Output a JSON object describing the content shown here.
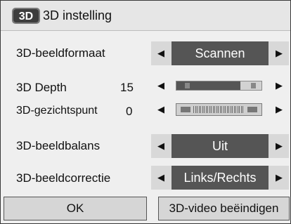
{
  "dialog": {
    "title": "3D instelling",
    "logo_text": "3D"
  },
  "rows": [
    {
      "label": "3D-beeldformaat",
      "value": "Scannen"
    },
    {
      "label": "3D Depth",
      "number": "15",
      "level": 15
    },
    {
      "label": "3D-gezichtspunt",
      "number": "0",
      "level": 0
    },
    {
      "label": "3D-beeldbalans",
      "value": "Uit"
    },
    {
      "label": "3D-beeldcorrectie",
      "value": "Links/Rechts"
    }
  ],
  "arrows": {
    "left": "◀",
    "right": "▶"
  },
  "buttons": {
    "ok": "OK",
    "end": "3D-video beëindigen"
  },
  "colors": {
    "selected_value_bg": "#555555",
    "row_box_bg": "#d8d8d8",
    "panel_bg": "#efefef"
  }
}
